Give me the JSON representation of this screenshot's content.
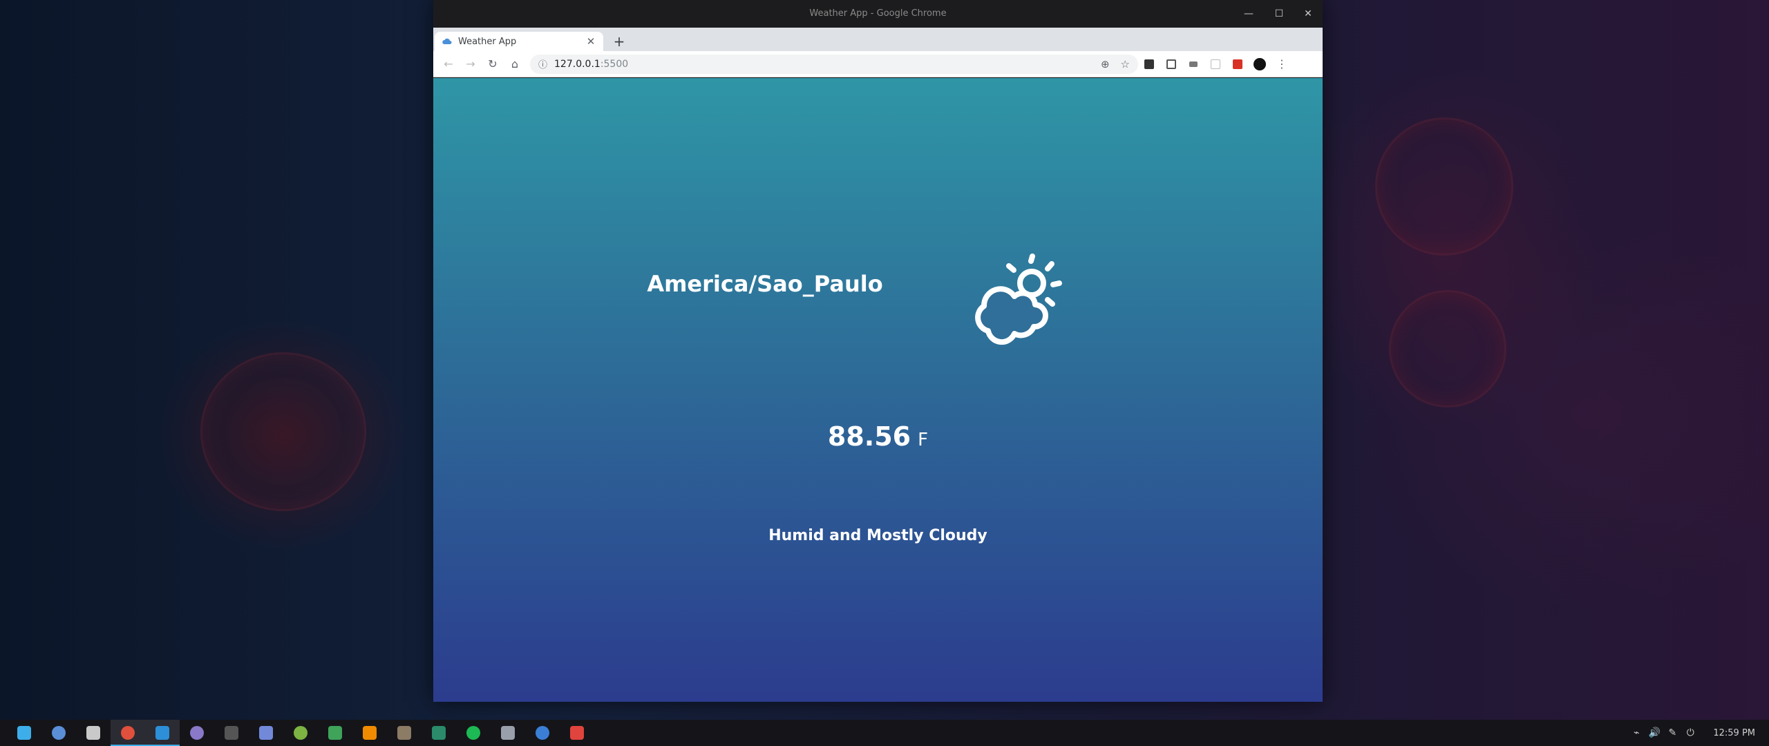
{
  "window": {
    "title": "Weather App - Google Chrome",
    "controls": {
      "minimize": "—",
      "maximize": "☐",
      "close": "✕"
    }
  },
  "tab": {
    "title": "Weather App",
    "close_glyph": "✕",
    "new_tab_glyph": "+",
    "favicon": "cloud-icon"
  },
  "toolbar": {
    "back_glyph": "←",
    "forward_glyph": "→",
    "reload_glyph": "↻",
    "home_glyph": "⌂",
    "menu_glyph": "⋮",
    "url_host": "127.0.0.1",
    "url_port": ":5500",
    "location_glyph": "⊕",
    "bookmark_glyph": "☆"
  },
  "weather": {
    "timezone": "America/Sao_Paulo",
    "temperature": "88.56",
    "unit": "F",
    "summary": "Humid and Mostly Cloudy",
    "icon": "partly-cloudy-day-icon"
  },
  "taskbar": {
    "apps": [
      {
        "name": "app-launcher",
        "color": "#3daee9"
      },
      {
        "name": "discover-store",
        "color": "#5a8fd8"
      },
      {
        "name": "file-manager",
        "color": "#c9c9c9"
      },
      {
        "name": "google-chrome",
        "color": "#e0503c",
        "active": true
      },
      {
        "name": "vscode",
        "color": "#2d8fd8",
        "active": true
      },
      {
        "name": "tor-browser",
        "color": "#8a78c8"
      },
      {
        "name": "terminal",
        "color": "#555555"
      },
      {
        "name": "discord",
        "color": "#7289da"
      },
      {
        "name": "android-studio",
        "color": "#7cb342"
      },
      {
        "name": "spreadsheet",
        "color": "#3fa35a"
      },
      {
        "name": "vlc",
        "color": "#f08a00"
      },
      {
        "name": "gimp",
        "color": "#8c7b65"
      },
      {
        "name": "inkscape",
        "color": "#2a8a6a"
      },
      {
        "name": "spotify",
        "color": "#1db954"
      },
      {
        "name": "virtualbox",
        "color": "#9aa0aa"
      },
      {
        "name": "qbittorrent",
        "color": "#3b7ed6"
      },
      {
        "name": "screen-recorder",
        "color": "#e0443c"
      }
    ],
    "tray": {
      "usb_glyph": "⌁",
      "volume_glyph": "🔊",
      "pen_glyph": "✎",
      "power_glyph": "⏻"
    },
    "clock": "12:59 PM"
  }
}
